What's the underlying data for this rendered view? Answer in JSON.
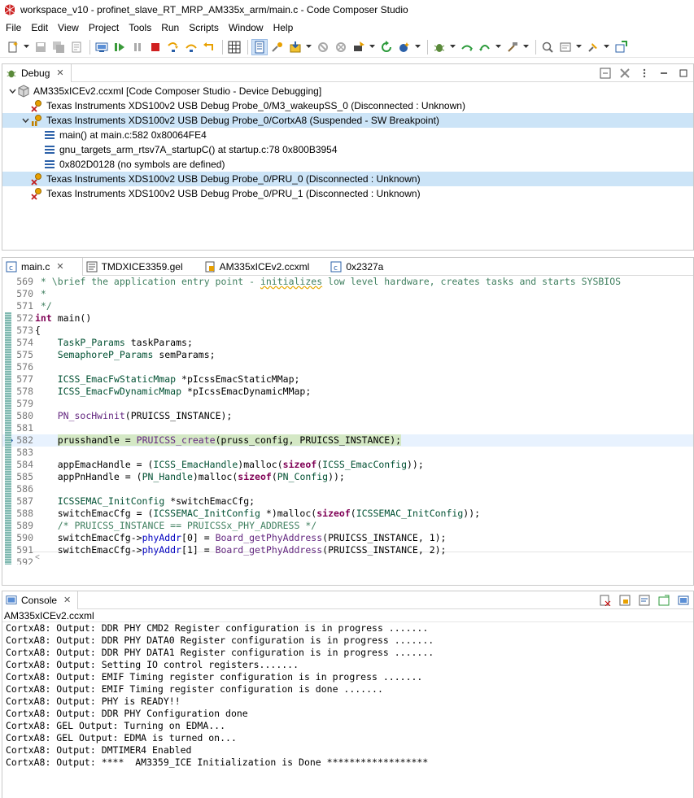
{
  "window": {
    "title": "workspace_v10 - profinet_slave_RT_MRP_AM335x_arm/main.c - Code Composer Studio"
  },
  "menu": [
    "File",
    "Edit",
    "View",
    "Project",
    "Tools",
    "Run",
    "Scripts",
    "Window",
    "Help"
  ],
  "debug_view": {
    "tab_label": "Debug",
    "tree": [
      {
        "label": "AM335xICEv2.ccxml [Code Composer Studio - Device Debugging]",
        "level": 0,
        "icon": "device-config-icon",
        "expanded": true,
        "selected": false
      },
      {
        "label": "Texas Instruments XDS100v2 USB Debug Probe_0/M3_wakeupSS_0 (Disconnected : Unknown)",
        "level": 1,
        "icon": "cpu-disconnected-icon",
        "expanded": false,
        "selected": false
      },
      {
        "label": "Texas Instruments XDS100v2 USB Debug Probe_0/CortxA8 (Suspended - SW Breakpoint)",
        "level": 1,
        "icon": "cpu-suspended-icon",
        "expanded": true,
        "selected": true
      },
      {
        "label": "main() at main.c:582 0x80064FE4",
        "level": 2,
        "icon": "stack-frame-icon",
        "expanded": false,
        "selected": false
      },
      {
        "label": "gnu_targets_arm_rtsv7A_startupC() at startup.c:78 0x800B3954",
        "level": 2,
        "icon": "stack-frame-icon",
        "expanded": false,
        "selected": false
      },
      {
        "label": "0x802D0128  (no symbols are defined)",
        "level": 2,
        "icon": "stack-frame-icon",
        "expanded": false,
        "selected": false
      },
      {
        "label": "Texas Instruments XDS100v2 USB Debug Probe_0/PRU_0 (Disconnected : Unknown)",
        "level": 1,
        "icon": "cpu-disconnected-icon",
        "expanded": false,
        "selected": true
      },
      {
        "label": "Texas Instruments XDS100v2 USB Debug Probe_0/PRU_1 (Disconnected : Unknown)",
        "level": 1,
        "icon": "cpu-disconnected-icon",
        "expanded": false,
        "selected": false
      }
    ]
  },
  "editor": {
    "tabs": [
      {
        "label": "main.c",
        "icon": "c-file-icon",
        "closable": true,
        "selected": true
      },
      {
        "label": "TMDXICE3359.gel",
        "icon": "gel-file-icon",
        "closable": false,
        "selected": false
      },
      {
        "label": "AM335xICEv2.ccxml",
        "icon": "ccxml-file-icon",
        "closable": false,
        "selected": false
      },
      {
        "label": "0x2327a",
        "icon": "c-file-icon",
        "closable": false,
        "selected": false
      }
    ],
    "current_line": "582",
    "lines": [
      {
        "n": "569",
        "text": " * \\brief the application entry point - initializes low level hardware, creates tasks and starts SYSBIOS"
      },
      {
        "n": "570",
        "text": " *"
      },
      {
        "n": "571",
        "text": " */"
      },
      {
        "n": "572",
        "text": "int main()"
      },
      {
        "n": "573",
        "text": "{"
      },
      {
        "n": "574",
        "text": "    TaskP_Params taskParams;"
      },
      {
        "n": "575",
        "text": "    SemaphoreP_Params semParams;"
      },
      {
        "n": "576",
        "text": ""
      },
      {
        "n": "577",
        "text": "    ICSS_EmacFwStaticMmap *pIcssEmacStaticMMap;"
      },
      {
        "n": "578",
        "text": "    ICSS_EmacFwDynamicMmap *pIcssEmacDynamicMMap;"
      },
      {
        "n": "579",
        "text": ""
      },
      {
        "n": "580",
        "text": "    PN_socHwinit(PRUICSS_INSTANCE);"
      },
      {
        "n": "581",
        "text": ""
      },
      {
        "n": "582",
        "text": "    prusshandle = PRUICSS_create(pruss_config, PRUICSS_INSTANCE);"
      },
      {
        "n": "583",
        "text": ""
      },
      {
        "n": "584",
        "text": "    appEmacHandle = (ICSS_EmacHandle)malloc(sizeof(ICSS_EmacConfig));"
      },
      {
        "n": "585",
        "text": "    appPnHandle = (PN_Handle)malloc(sizeof(PN_Config));"
      },
      {
        "n": "586",
        "text": ""
      },
      {
        "n": "587",
        "text": "    ICSSEMAC_InitConfig *switchEmacCfg;"
      },
      {
        "n": "588",
        "text": "    switchEmacCfg = (ICSSEMAC_InitConfig *)malloc(sizeof(ICSSEMAC_InitConfig));"
      },
      {
        "n": "589",
        "text": "    /* PRUICSS_INSTANCE == PRUICSSx_PHY_ADDRESS */"
      },
      {
        "n": "590",
        "text": "    switchEmacCfg->phyAddr[0] = Board_getPhyAddress(PRUICSS_INSTANCE, 1);"
      },
      {
        "n": "591",
        "text": "    switchEmacCfg->phyAddr[1] = Board_getPhyAddress(PRUICSS_INSTANCE, 2);"
      },
      {
        "n": "592",
        "text": ""
      }
    ]
  },
  "console": {
    "tab_label": "Console",
    "subtitle": "AM335xICEv2.ccxml",
    "lines": [
      "CortxA8: Output: DDR PHY CMD2 Register configuration is in progress .......",
      "CortxA8: Output: DDR PHY DATA0 Register configuration is in progress .......",
      "CortxA8: Output: DDR PHY DATA1 Register configuration is in progress .......",
      "CortxA8: Output: Setting IO control registers.......",
      "CortxA8: Output: EMIF Timing register configuration is in progress .......",
      "CortxA8: Output: EMIF Timing register configuration is done .......",
      "CortxA8: Output: PHY is READY!!",
      "CortxA8: Output: DDR PHY Configuration done",
      "CortxA8: GEL Output: Turning on EDMA...",
      "CortxA8: GEL Output: EDMA is turned on...",
      "CortxA8: Output: DMTIMER4 Enabled",
      "CortxA8: Output: ****  AM3359_ICE Initialization is Done ******************"
    ]
  },
  "colors": {
    "selection": "#cce4f7",
    "current_line": "#e8f2fe",
    "pc_highlight": "#d4e8c5",
    "comment": "#3f7f5f",
    "keyword": "#7f0055"
  }
}
